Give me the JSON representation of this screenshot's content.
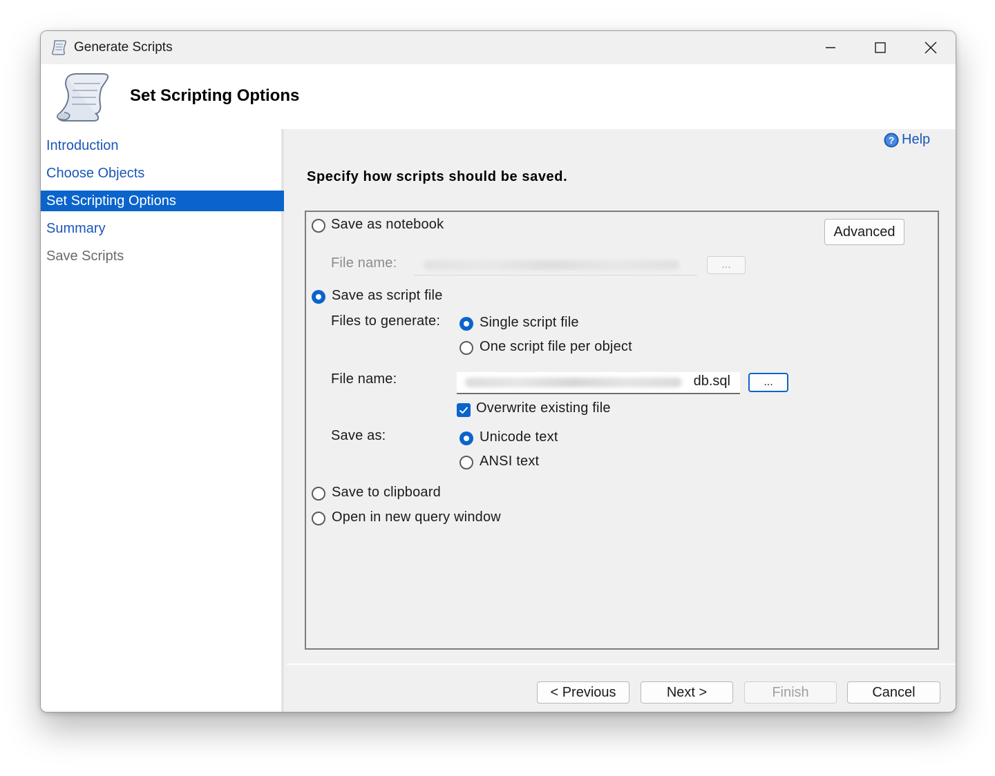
{
  "window": {
    "title": "Generate Scripts",
    "controls": [
      "minimize-icon",
      "maximize-icon",
      "close-icon"
    ]
  },
  "header": {
    "title": "Set Scripting Options",
    "icon": "script-scroll-icon"
  },
  "sidebar": {
    "items": [
      {
        "label": "Introduction",
        "state": "link"
      },
      {
        "label": "Choose Objects",
        "state": "link"
      },
      {
        "label": "Set Scripting Options",
        "state": "selected"
      },
      {
        "label": "Summary",
        "state": "link"
      },
      {
        "label": "Save Scripts",
        "state": "disabled"
      }
    ]
  },
  "help": {
    "label": "Help",
    "icon": "help-icon"
  },
  "instruction": "Specify how scripts should be saved.",
  "options": {
    "save_as_notebook": {
      "label": "Save as notebook",
      "checked": false
    },
    "advanced_button": "Advanced",
    "notebook_file_label": "File name:",
    "notebook_browse": "...",
    "save_as_script_file": {
      "label": "Save as script file",
      "checked": true
    },
    "files_to_generate_label": "Files to generate:",
    "single_script_file": {
      "label": "Single script file",
      "checked": true
    },
    "one_script_per_object": {
      "label": "One script file per object",
      "checked": false
    },
    "file_name_label": "File name:",
    "file_name_value_suffix": "db.sql",
    "browse_button": "...",
    "overwrite_existing": {
      "label": "Overwrite existing file",
      "checked": true
    },
    "save_as_label": "Save as:",
    "unicode_text": {
      "label": "Unicode text",
      "checked": true
    },
    "ansi_text": {
      "label": "ANSI text",
      "checked": false
    },
    "save_to_clipboard": {
      "label": "Save to clipboard",
      "checked": false
    },
    "open_in_query_window": {
      "label": "Open in new query window",
      "checked": false
    }
  },
  "footer": {
    "previous": "< Previous",
    "next": "Next >",
    "finish": "Finish",
    "cancel": "Cancel"
  },
  "colors": {
    "accent": "#0a64cc",
    "link": "#1a56b8",
    "window_bg": "#f0f0f0"
  }
}
